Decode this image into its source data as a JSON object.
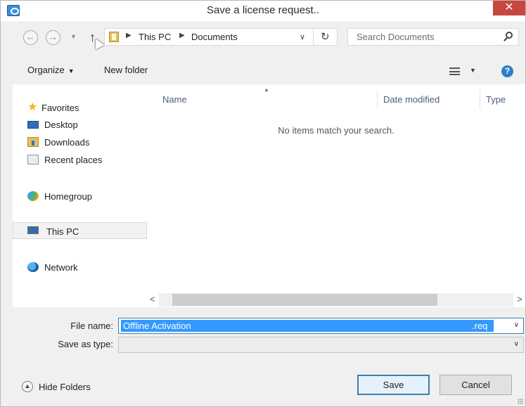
{
  "window": {
    "title": "Save a license request.."
  },
  "navigation": {
    "breadcrumb": [
      "This PC",
      "Documents"
    ],
    "search_placeholder": "Search Documents"
  },
  "toolbar": {
    "organize_label": "Organize",
    "new_folder_label": "New folder"
  },
  "nav_pane": {
    "items": [
      {
        "label": "Favorites",
        "icon": "star-icon"
      },
      {
        "label": "Desktop",
        "icon": "desktop-icon"
      },
      {
        "label": "Downloads",
        "icon": "downloads-icon"
      },
      {
        "label": "Recent places",
        "icon": "recent-places-icon"
      },
      {
        "label": "Homegroup",
        "icon": "homegroup-icon"
      },
      {
        "label": "This PC",
        "icon": "computer-icon",
        "selected": true
      },
      {
        "label": "Network",
        "icon": "network-icon"
      }
    ]
  },
  "file_list": {
    "columns": [
      "Name",
      "Date modified",
      "Type"
    ],
    "empty_message": "No items match your search."
  },
  "form": {
    "file_name_label": "File name:",
    "file_name_value": "Offline Activation",
    "file_extension": ".req",
    "save_type_label": "Save as type:",
    "save_type_value": ""
  },
  "footer": {
    "hide_folders_label": "Hide Folders",
    "save_label": "Save",
    "cancel_label": "Cancel"
  },
  "colors": {
    "selection": "#3399ff",
    "close_button": "#c7463e",
    "accent": "#3c7fb1"
  }
}
